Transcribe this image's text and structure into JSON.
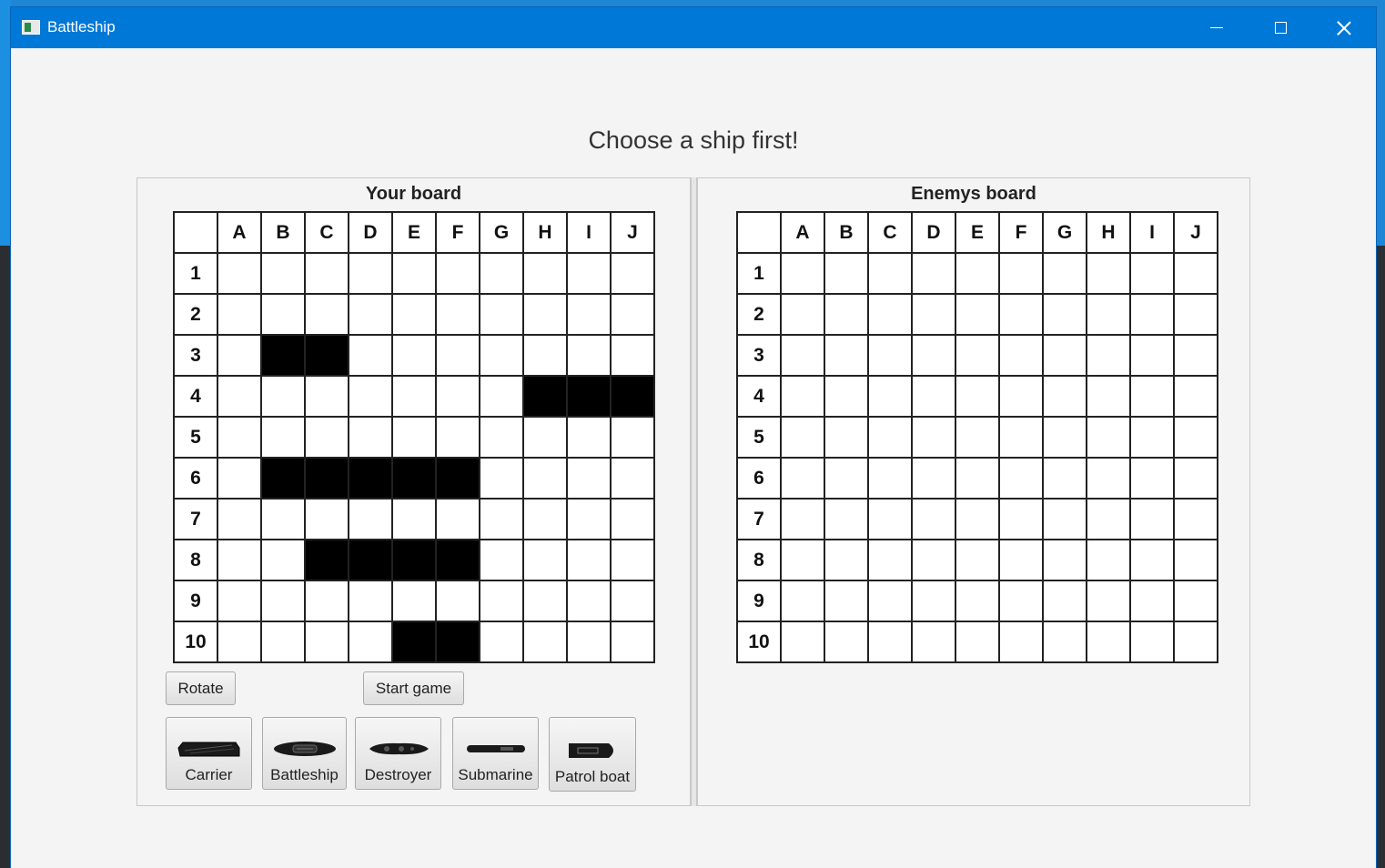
{
  "window": {
    "title": "Battleship"
  },
  "status_text": "Choose a ship first!",
  "columns": [
    "A",
    "B",
    "C",
    "D",
    "E",
    "F",
    "G",
    "H",
    "I",
    "J"
  ],
  "rows": [
    "1",
    "2",
    "3",
    "4",
    "5",
    "6",
    "7",
    "8",
    "9",
    "10"
  ],
  "your_board": {
    "title": "Your board",
    "ship_cells": [
      "B3",
      "C3",
      "H4",
      "I4",
      "J4",
      "B6",
      "C6",
      "D6",
      "E6",
      "F6",
      "C8",
      "D8",
      "E8",
      "F8",
      "E10",
      "F10"
    ]
  },
  "enemy_board": {
    "title": "Enemys board",
    "ship_cells": []
  },
  "controls": {
    "rotate_label": "Rotate",
    "start_label": "Start game"
  },
  "ships": [
    {
      "key": "carrier",
      "label": "Carrier",
      "icon": "carrier-icon"
    },
    {
      "key": "battleship",
      "label": "Battleship",
      "icon": "battleship-icon"
    },
    {
      "key": "destroyer",
      "label": "Destroyer",
      "icon": "destroyer-icon"
    },
    {
      "key": "submarine",
      "label": "Submarine",
      "icon": "submarine-icon"
    },
    {
      "key": "patrol",
      "label": "Patrol boat",
      "icon": "patrol-boat-icon"
    }
  ]
}
